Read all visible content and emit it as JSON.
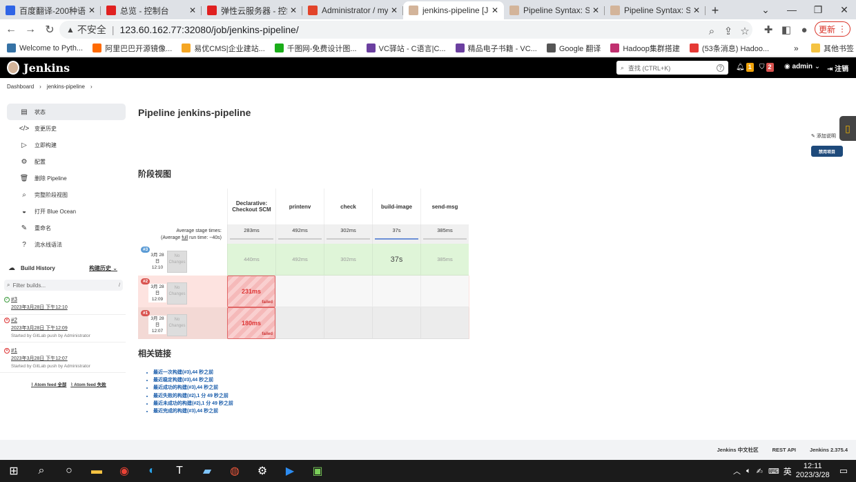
{
  "browser": {
    "tabs": [
      {
        "title": "百度翻译-200种语言",
        "color": "#2f64e6",
        "active": false
      },
      {
        "title": "总览 - 控制台",
        "color": "#e02020",
        "active": false
      },
      {
        "title": "弹性云服务器 - 控制台",
        "color": "#e02020",
        "active": false
      },
      {
        "title": "Administrator / myb",
        "color": "#e2432a",
        "active": false
      },
      {
        "title": "jenkins-pipeline [Jenkins]",
        "color": "#d3b49a",
        "active": true
      },
      {
        "title": "Pipeline Syntax: Snip",
        "color": "#d3b49a",
        "active": false
      },
      {
        "title": "Pipeline Syntax: Snip",
        "color": "#d3b49a",
        "active": false
      }
    ],
    "new_tab": "+",
    "security": "不安全",
    "url": "123.60.162.77:32080/job/jenkins-pipeline/",
    "update_label": "更新",
    "bookmarks": [
      {
        "label": "Welcome to Pyth...",
        "color": "#3572a5"
      },
      {
        "label": "阿里巴巴开源镜像...",
        "color": "#ff6a00"
      },
      {
        "label": "易优CMS|企业建站...",
        "color": "#f5a623"
      },
      {
        "label": "千图网-免费设计图...",
        "color": "#1aad19"
      },
      {
        "label": "VC驿站 - C语言|C...",
        "color": "#6b3fa0"
      },
      {
        "label": "精品电子书籍 - VC...",
        "color": "#6b3fa0"
      },
      {
        "label": "Google 翻译",
        "color": "#555555"
      },
      {
        "label": "Hadoop集群搭建",
        "color": "#c0306f"
      },
      {
        "label": "(53条消息) Hadoo...",
        "color": "#e53935"
      }
    ],
    "more_bookmarks": "»",
    "other_bookmarks": "其他书签"
  },
  "header": {
    "brand": "Jenkins",
    "search_placeholder": "查找 (CTRL+K)",
    "notif_count": "1",
    "security_count": "2",
    "user": "admin",
    "logout": "注销"
  },
  "breadcrumb": [
    "Dashboard",
    "jenkins-pipeline"
  ],
  "sidebar": {
    "items": [
      {
        "label": "状态",
        "icon": "clipboard-icon",
        "glyph": "▤",
        "selected": true
      },
      {
        "label": "变更历史",
        "icon": "code-icon",
        "glyph": "</>",
        "selected": false
      },
      {
        "label": "立即构建",
        "icon": "play-icon",
        "glyph": "▷",
        "selected": false
      },
      {
        "label": "配置",
        "icon": "gear-icon",
        "glyph": "⚙",
        "selected": false
      },
      {
        "label": "删除 Pipeline",
        "icon": "trash-icon",
        "glyph": "🗑",
        "selected": false
      },
      {
        "label": "完整阶段视图",
        "icon": "search-icon",
        "glyph": "⌕",
        "selected": false
      },
      {
        "label": "打开 Blue Ocean",
        "icon": "blue-ocean-icon",
        "glyph": "◒",
        "selected": false
      },
      {
        "label": "重命名",
        "icon": "pencil-icon",
        "glyph": "✎",
        "selected": false
      },
      {
        "label": "流水线语法",
        "icon": "help-icon",
        "glyph": "?",
        "selected": false
      }
    ],
    "build_history_title": "Build History",
    "build_history_cn": "构建历史",
    "filter_placeholder": "Filter builds...",
    "filter_key": "/",
    "builds": [
      {
        "num": "#3",
        "status": "success",
        "date": "2023年3月28日 下午12:10",
        "by": ""
      },
      {
        "num": "#2",
        "status": "failed",
        "date": "2023年3月28日 下午12:09",
        "by": "Started by GitLab push by Administrator"
      },
      {
        "num": "#1",
        "status": "failed",
        "date": "2023年3月28日 下午12:07",
        "by": "Started by GitLab push by Administrator"
      }
    ],
    "feed_all": "Atom feed 全部",
    "feed_fail": "Atom feed 失败"
  },
  "main": {
    "title": "Pipeline jenkins-pipeline",
    "add_desc": "添加说明",
    "disable_btn": "禁用项目",
    "stage_title": "阶段视图",
    "avg_label_1": "Average stage times:",
    "avg_label_2a": "(Average ",
    "avg_label_full": "full",
    "avg_label_2b": " run time: ~40s)",
    "stages": [
      "Declarative: Checkout SCM",
      "printenv",
      "check",
      "build-image",
      "send-msg"
    ],
    "avg_times": [
      "283ms",
      "492ms",
      "302ms",
      "37s",
      "385ms"
    ],
    "runs": [
      {
        "badge": "#3",
        "badge_color": "#5b9bd5",
        "date_lines": [
          "3月 28",
          "日",
          "12:10"
        ],
        "no_changes": "No Changes",
        "bg": "#ffffff",
        "cells": [
          "440ms",
          "492ms",
          "302ms",
          "37s",
          "385ms"
        ],
        "cell_states": [
          "ok",
          "ok",
          "ok",
          "ok",
          "ok"
        ]
      },
      {
        "badge": "#2",
        "badge_color": "#d9534f",
        "date_lines": [
          "3月 28",
          "日",
          "12:09"
        ],
        "no_changes": "No Changes",
        "bg": "#fde3e0",
        "cells": [
          "231ms",
          "",
          "",
          "",
          ""
        ],
        "cell_states": [
          "fail",
          "empty",
          "empty",
          "empty",
          "empty"
        ],
        "fail_label": "failed"
      },
      {
        "badge": "#1",
        "badge_color": "#d9534f",
        "date_lines": [
          "3月 28",
          "日",
          "12:07"
        ],
        "no_changes": "No Changes",
        "bg": "#f3d9d5",
        "cells": [
          "180ms",
          "",
          "",
          "",
          ""
        ],
        "cell_states": [
          "fail",
          "empty",
          "empty",
          "empty",
          "empty"
        ],
        "fail_label": "failed"
      }
    ],
    "links_title": "相关链接",
    "links": [
      "最近一次构建(#3),44 秒之前",
      "最近稳定构建(#3),44 秒之前",
      "最近成功的构建(#3),44 秒之前",
      "最近失败的构建(#2),1 分 49 秒之前",
      "最近未成功的构建(#2),1 分 49 秒之前",
      "最近完成的构建(#3),44 秒之前"
    ]
  },
  "footer": {
    "community": "Jenkins 中文社区",
    "rest": "REST API",
    "version": "Jenkins 2.375.4"
  },
  "taskbar": {
    "ime": "英",
    "time": "12:11",
    "date": "2023/3/28"
  }
}
